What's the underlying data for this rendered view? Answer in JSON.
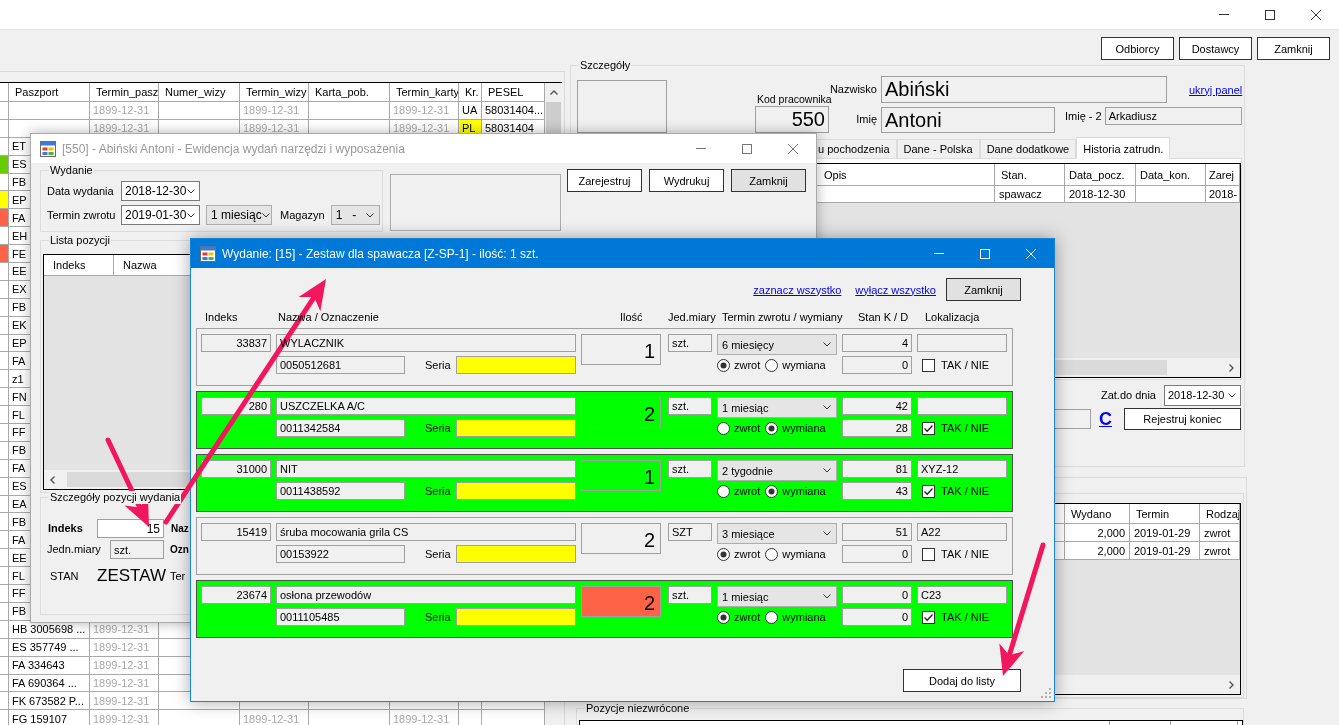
{
  "main_window": {
    "toolbar_buttons": [
      {
        "label": "Odbiorcy",
        "kind": "flat"
      },
      {
        "label": "Dostawcy",
        "kind": "flat"
      },
      {
        "label": "Zamknij",
        "kind": "flat"
      }
    ],
    "employees_grid": {
      "columns": [
        {
          "label": "Paszport"
        },
        {
          "label": "Termin_pasz",
          "kind": "date"
        },
        {
          "label": "Numer_wizy"
        },
        {
          "label": "Termin_wizy",
          "kind": "date"
        },
        {
          "label": "Karta_pob."
        },
        {
          "label": "Termin_karty",
          "kind": "date"
        },
        {
          "label": "Kr."
        },
        {
          "label": "PESEL"
        }
      ],
      "rows": [
        {
          "cells": [
            null,
            "1899-12-31",
            null,
            "1899-12-31",
            null,
            "1899-12-31",
            "UA",
            "58031404..."
          ]
        },
        {
          "cells": [
            null,
            "1899-12-31",
            null,
            "1899-12-31",
            null,
            "1899-12-31",
            {
              "text": "PL",
              "color": "#ffff00"
            },
            "58031404"
          ]
        },
        {
          "cells": [
            "ET"
          ]
        },
        {
          "cells": [
            "ES"
          ],
          "color": "#66cc00"
        },
        {
          "cells": [
            "FB"
          ]
        },
        {
          "cells": [
            "EP"
          ],
          "color": "#ffff00"
        },
        {
          "cells": [
            "FA"
          ],
          "color": "#ff6347"
        },
        {
          "cells": [
            "EH"
          ]
        },
        {
          "cells": [
            "FE"
          ],
          "color": "#ff6347"
        },
        {
          "cells": [
            "EE"
          ]
        },
        {
          "cells": [
            "EX"
          ]
        },
        {
          "cells": [
            "FB"
          ]
        },
        {
          "cells": [
            "EK"
          ]
        },
        {
          "cells": [
            "EP"
          ]
        },
        {
          "cells": [
            "FA"
          ]
        },
        {
          "cells": [
            "z1"
          ]
        },
        {
          "cells": [
            "FN"
          ]
        },
        {
          "cells": [
            "FL"
          ]
        },
        {
          "cells": [
            "FF"
          ]
        },
        {
          "cells": [
            "FB"
          ]
        },
        {
          "cells": [
            "FA"
          ]
        },
        {
          "cells": [
            "ES"
          ]
        },
        {
          "cells": [
            "EA"
          ]
        },
        {
          "cells": [
            "FB"
          ]
        },
        {
          "cells": [
            "FA"
          ]
        },
        {
          "cells": [
            "EE"
          ]
        },
        {
          "cells": [
            "FL"
          ]
        },
        {
          "cells": [
            "FF"
          ]
        },
        {
          "cells": [
            "FB"
          ]
        },
        {
          "cells": [
            "HB 3005698 ...",
            "1899-12-31"
          ]
        },
        {
          "cells": [
            "ES 357749 ...",
            "1899-12-31"
          ]
        },
        {
          "cells": [
            "FA 334643",
            "1899-12-31"
          ]
        },
        {
          "cells": [
            "FA 690364 ...",
            "1899-12-31"
          ]
        },
        {
          "cells": [
            "FK 673582 P...",
            "1899-12-31"
          ]
        },
        {
          "cells": [
            "FG 159107",
            "1899-12-31",
            null,
            "1899-12-31",
            null,
            "1899-12-31"
          ]
        }
      ]
    },
    "details": {
      "title": "Szczegóły",
      "employee_code_label": "Kod pracownika",
      "employee_code": "550",
      "surname_label": "Nazwisko",
      "surname": "Abiński",
      "first_name_label": "Imię",
      "first_name": "Antoni",
      "second_name_label": "Imię - 2",
      "second_name": "Arkadiusz",
      "hide_panel_link": "ukryj panel",
      "tabs": [
        {
          "label": "u pochodzenia",
          "selected": false
        },
        {
          "label": "Dane - Polska",
          "selected": false
        },
        {
          "label": "Dane dodatkowe",
          "selected": false
        },
        {
          "label": "Historia zatrudn.",
          "selected": true
        }
      ],
      "history_grid": {
        "columns": [
          "Opis",
          "Stan.",
          "Data_pocz.",
          "Data_kon.",
          "Zarej"
        ],
        "rows": [
          {
            "cells": [
              null,
              "spawacz",
              "2018-12-30",
              null,
              "2018-"
            ]
          }
        ]
      },
      "employed_until_label": "Zat.do dnia",
      "employed_until": "2018-12-30",
      "clear_link": "C",
      "register_end_button": {
        "label": "Rejestruj koniec",
        "kind": "flat"
      }
    },
    "issued_grid": {
      "columns": [
        "Wydano",
        "Termin",
        "Rodzaj"
      ],
      "rows": [
        {
          "cells": [
            "2,000",
            "2019-01-29",
            "zwrot"
          ]
        },
        {
          "cells": [
            "2,000",
            "2019-01-29",
            "zwrot"
          ]
        }
      ]
    },
    "unreturned_group": {
      "title": "Pozycje niezwrócone"
    }
  },
  "issue_window": {
    "title": "[550] - Abiński Antoni - Ewidencja wydań narzędzi i wyposażenia",
    "active": false,
    "issue_group": {
      "title": "Wydanie",
      "issue_date_label": "Data wydania",
      "issue_date": "2018-12-30",
      "return_date_label": "Termin zwrotu",
      "return_date": "2019-01-30",
      "period": "1 miesiąc",
      "warehouse_label": "Magazyn",
      "warehouse": "1   -"
    },
    "buttons": [
      {
        "label": "Zarejestruj",
        "kind": "flat"
      },
      {
        "label": "Wydrukuj",
        "kind": "flat"
      },
      {
        "label": "Zamknij",
        "kind": "standard"
      }
    ],
    "positions_group": {
      "title": "Lista pozycji",
      "columns": [
        "Indeks",
        "Nazwa"
      ]
    },
    "item_group": {
      "title": "Szczegóły pozycji wydania",
      "index_label": "Indeks",
      "index": "15",
      "name_label": "Naz",
      "unit_label": "Jedn.miary",
      "unit": "szt.",
      "designation_label": "Ozn",
      "status_label": "STAN",
      "status": "ZESTAW",
      "term_label": "Ter"
    }
  },
  "set_window": {
    "title": "Wydanie: [15] - Zestaw dla spawacza [Z-SP-1] - ilość: 1 szt.",
    "active": true,
    "links": [
      "zaznacz wszystko",
      "wyłącz wszystko"
    ],
    "close_button": {
      "label": "Zamknij",
      "kind": "standard"
    },
    "columns": [
      "Indeks",
      "Nazwa / Oznaczenie",
      "Ilość",
      "Jed.miary",
      "Termin zwrotu / wymiany",
      "Stan K / D",
      "Lokalizacja"
    ],
    "items": [
      {
        "index": "33837",
        "name": "WYLACZNIK",
        "code": "0050512681",
        "series_label": "Seria",
        "quantity": "1",
        "shortage": false,
        "unit": "szt.",
        "term": "6 miesięcy",
        "options": [
          {
            "label": "zwrot",
            "selected": true
          },
          {
            "label": "wymiana",
            "selected": false
          }
        ],
        "stock_k": "4",
        "stock_d": "0",
        "checkbox_label": "TAK / NIE",
        "checked": false
      },
      {
        "index": "280",
        "name": "USZCZELKA A/C",
        "code": "0011342584",
        "series_label": "Seria",
        "quantity": "2",
        "shortage": false,
        "unit": "szt.",
        "term": "1 miesiąc",
        "options": [
          {
            "label": "zwrot",
            "selected": false
          },
          {
            "label": "wymiana",
            "selected": true
          }
        ],
        "stock_k": "42",
        "stock_d": "28",
        "checkbox_label": "TAK / NIE",
        "checked": true
      },
      {
        "index": "31000",
        "name": "NIT",
        "code": "0011438592",
        "series_label": "Seria",
        "quantity": "1",
        "shortage": false,
        "unit": "szt.",
        "term": "2 tygodnie",
        "options": [
          {
            "label": "zwrot",
            "selected": false
          },
          {
            "label": "wymiana",
            "selected": true
          }
        ],
        "stock_k": "81",
        "stock_d": "43",
        "location": "XYZ-12",
        "checkbox_label": "TAK / NIE",
        "checked": true
      },
      {
        "index": "15419",
        "name": "śruba mocowania grila CS",
        "code": "00153922",
        "series_label": "Seria",
        "quantity": "2",
        "shortage": false,
        "unit": "SZT",
        "term": "3 miesiące",
        "options": [
          {
            "label": "zwrot",
            "selected": true
          },
          {
            "label": "wymiana",
            "selected": false
          }
        ],
        "stock_k": "51",
        "stock_d": "0",
        "location": "A22",
        "checkbox_label": "TAK / NIE",
        "checked": false
      },
      {
        "index": "23674",
        "name": "osłona przewodów",
        "code": "0011105485",
        "series_label": "Seria",
        "quantity": "2",
        "shortage": true,
        "unit": "szt.",
        "term": "1 miesiąc",
        "options": [
          {
            "label": "zwrot",
            "selected": true
          },
          {
            "label": "wymiana",
            "selected": false
          }
        ],
        "stock_k": "0",
        "stock_d": "0",
        "location": "C23",
        "checkbox_label": "TAK / NIE",
        "checked": true
      }
    ],
    "add_button": {
      "label": "Dodaj do listy",
      "kind": "flat"
    }
  }
}
